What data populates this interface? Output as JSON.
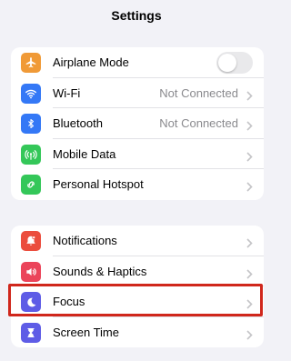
{
  "header": {
    "title": "Settings"
  },
  "group1": [
    {
      "key": "airplane",
      "label": "Airplane Mode",
      "detail": "",
      "icon": "airplane-icon",
      "icon_color": "#f09a37",
      "control": "toggle",
      "toggle_on": false
    },
    {
      "key": "wifi",
      "label": "Wi-Fi",
      "detail": "Not Connected",
      "icon": "wifi-icon",
      "icon_color": "#3478f6",
      "control": "chevron"
    },
    {
      "key": "bluetooth",
      "label": "Bluetooth",
      "detail": "Not Connected",
      "icon": "bluetooth-icon",
      "icon_color": "#3478f6",
      "control": "chevron"
    },
    {
      "key": "mobile-data",
      "label": "Mobile Data",
      "detail": "",
      "icon": "antenna-icon",
      "icon_color": "#34c759",
      "control": "chevron"
    },
    {
      "key": "hotspot",
      "label": "Personal Hotspot",
      "detail": "",
      "icon": "hotspot-icon",
      "icon_color": "#34c759",
      "control": "chevron"
    }
  ],
  "group2": [
    {
      "key": "notifications",
      "label": "Notifications",
      "detail": "",
      "icon": "bell-icon",
      "icon_color": "#eb4d3d",
      "control": "chevron"
    },
    {
      "key": "sounds",
      "label": "Sounds & Haptics",
      "detail": "",
      "icon": "speaker-icon",
      "icon_color": "#eb445a",
      "control": "chevron"
    },
    {
      "key": "focus",
      "label": "Focus",
      "detail": "",
      "icon": "moon-icon",
      "icon_color": "#5e5ce6",
      "control": "chevron"
    },
    {
      "key": "screen-time",
      "label": "Screen Time",
      "detail": "",
      "icon": "hourglass-icon",
      "icon_color": "#5e5ce6",
      "control": "chevron"
    }
  ],
  "highlight": {
    "target": "focus",
    "color": "#d0271c"
  }
}
